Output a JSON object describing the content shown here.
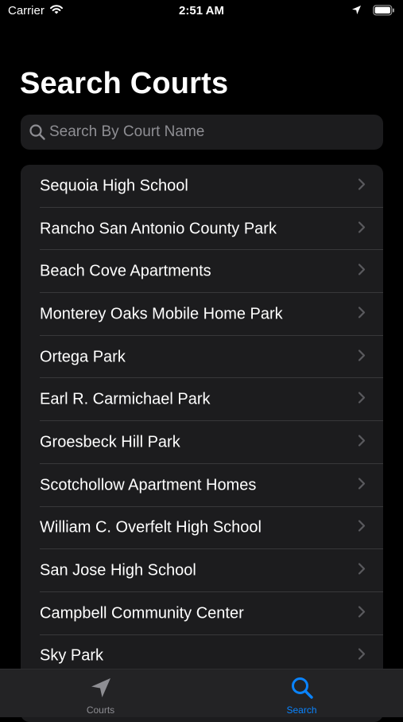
{
  "status_bar": {
    "carrier": "Carrier",
    "time": "2:51 AM"
  },
  "page": {
    "title": "Search Courts"
  },
  "search": {
    "placeholder": "Search By Court Name",
    "value": ""
  },
  "courts": [
    "Sequoia High School",
    "Rancho San Antonio County Park",
    "Beach Cove Apartments",
    "Monterey Oaks Mobile Home Park",
    "Ortega Park",
    "Earl R. Carmichael Park",
    "Groesbeck Hill Park",
    "Scotchollow Apartment Homes",
    "William C. Overfelt High School",
    "San Jose High School",
    "Campbell Community Center",
    "Sky Park"
  ],
  "tab_bar": {
    "tabs": [
      {
        "label": "Courts",
        "icon": "location-arrow-icon",
        "color": "#8e8e93",
        "selected": false
      },
      {
        "label": "Search",
        "icon": "search-icon",
        "color": "#0a84ff",
        "selected": true
      }
    ]
  },
  "colors": {
    "accent": "#0a84ff",
    "inactive": "#8e8e93",
    "background": "#000000",
    "surface": "#1c1c1e"
  }
}
